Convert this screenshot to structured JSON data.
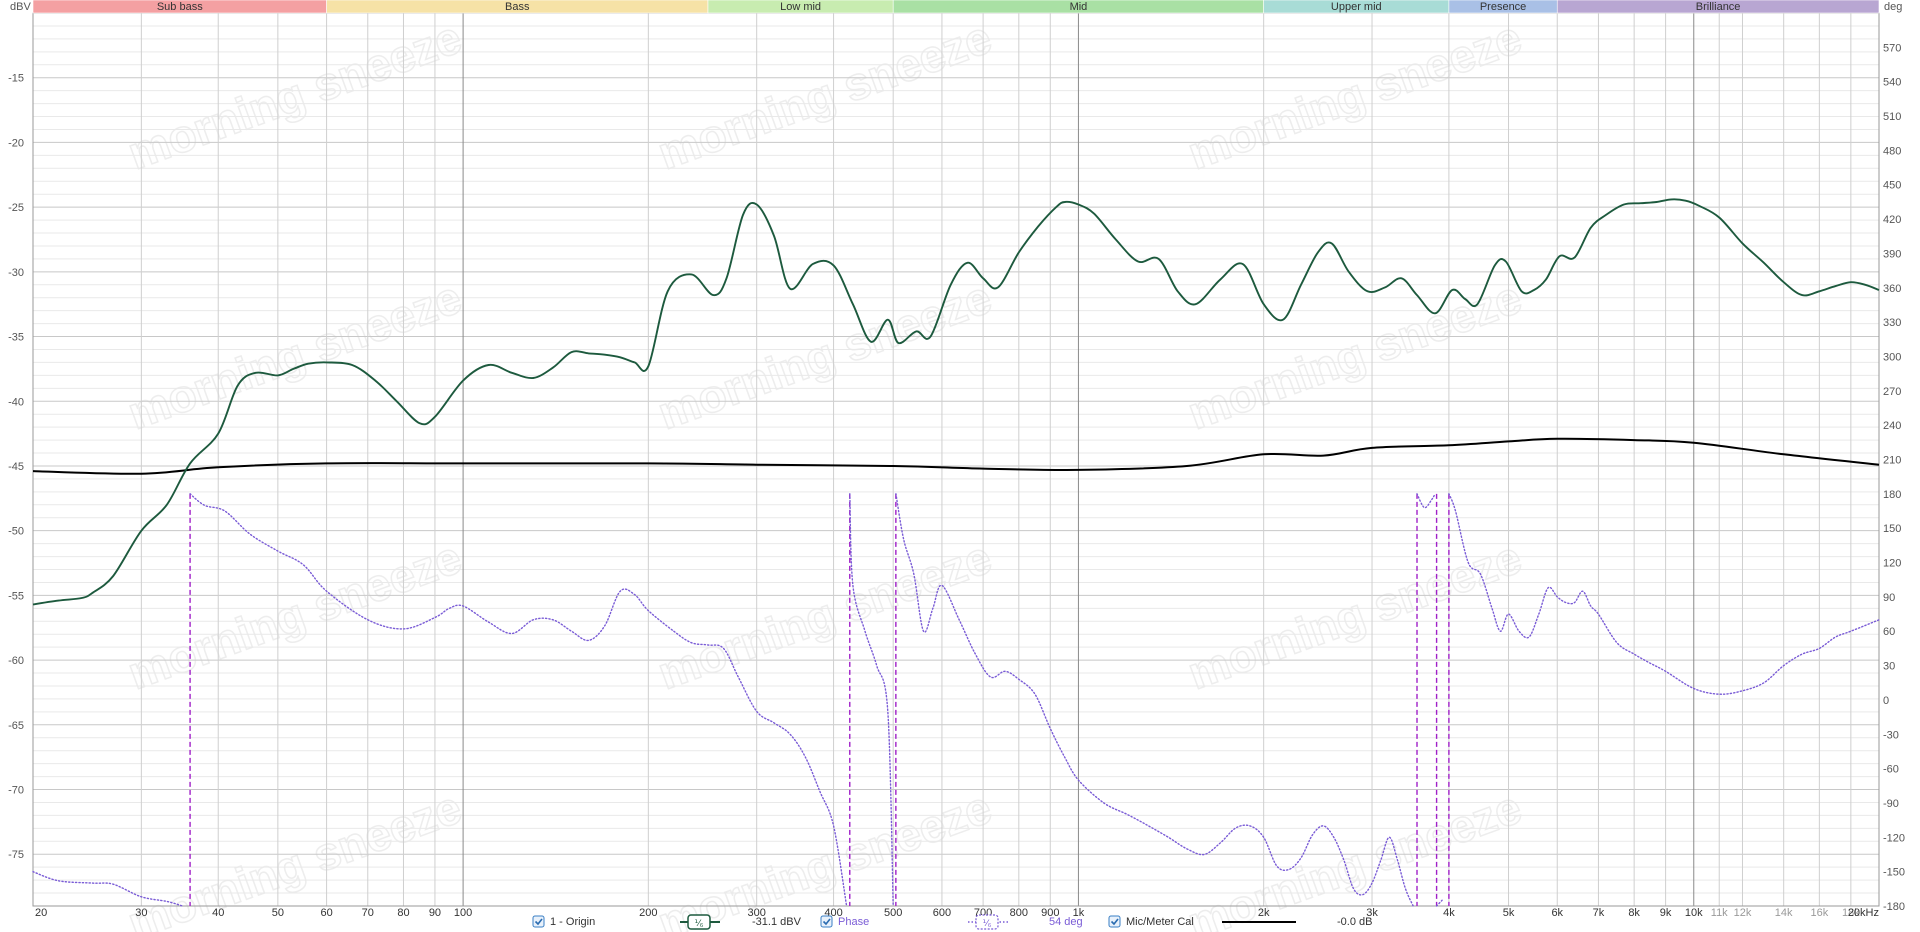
{
  "chart_data": {
    "type": "line",
    "bands": [
      {
        "name": "Sub bass",
        "from": 20,
        "to": 60,
        "color": "#f4a0a2"
      },
      {
        "name": "Bass",
        "from": 60,
        "to": 250,
        "color": "#f6e2a6"
      },
      {
        "name": "Low mid",
        "from": 250,
        "to": 500,
        "color": "#c8ecb0"
      },
      {
        "name": "Mid",
        "from": 500,
        "to": 2000,
        "color": "#a9e0a4"
      },
      {
        "name": "Upper mid",
        "from": 2000,
        "to": 4000,
        "color": "#a8dcd6"
      },
      {
        "name": "Presence",
        "from": 4000,
        "to": 6000,
        "color": "#a9c0e6"
      },
      {
        "name": "Brilliance",
        "from": 6000,
        "to": 20000,
        "color": "#b8a6d2"
      }
    ],
    "ylabel_left": "dBV",
    "ylabel_right": "deg",
    "xlim": [
      20,
      20000
    ],
    "ylim": [
      -79,
      -10
    ],
    "ylim_right": [
      -180,
      600
    ],
    "yticks_left": [
      -15,
      -20,
      -25,
      -30,
      -35,
      -40,
      -45,
      -50,
      -55,
      -60,
      -65,
      -70,
      -75
    ],
    "yticks_right": [
      570,
      540,
      510,
      480,
      450,
      420,
      390,
      360,
      330,
      300,
      270,
      240,
      210,
      180,
      150,
      120,
      90,
      60,
      30,
      0,
      -30,
      -60,
      -90,
      -120,
      -150,
      -180
    ],
    "xticks": [
      {
        "v": 20,
        "label": "20"
      },
      {
        "v": 30,
        "label": "30"
      },
      {
        "v": 40,
        "label": "40"
      },
      {
        "v": 50,
        "label": "50"
      },
      {
        "v": 60,
        "label": "60"
      },
      {
        "v": 70,
        "label": "70"
      },
      {
        "v": 80,
        "label": "80"
      },
      {
        "v": 90,
        "label": "90"
      },
      {
        "v": 100,
        "label": "100"
      },
      {
        "v": 200,
        "label": "200"
      },
      {
        "v": 300,
        "label": "300"
      },
      {
        "v": 400,
        "label": "400"
      },
      {
        "v": 500,
        "label": "500"
      },
      {
        "v": 600,
        "label": "600"
      },
      {
        "v": 700,
        "label": "700"
      },
      {
        "v": 800,
        "label": "800"
      },
      {
        "v": 900,
        "label": "900"
      },
      {
        "v": 1000,
        "label": "1k"
      },
      {
        "v": 2000,
        "label": "2k"
      },
      {
        "v": 3000,
        "label": "3k"
      },
      {
        "v": 4000,
        "label": "4k"
      },
      {
        "v": 5000,
        "label": "5k"
      },
      {
        "v": 6000,
        "label": "6k"
      },
      {
        "v": 7000,
        "label": "7k"
      },
      {
        "v": 8000,
        "label": "8k"
      },
      {
        "v": 9000,
        "label": "9k"
      },
      {
        "v": 10000,
        "label": "10k"
      },
      {
        "v": 11000,
        "label": "11k",
        "faint": true
      },
      {
        "v": 12000,
        "label": "12k",
        "faint": true
      },
      {
        "v": 14000,
        "label": "14k",
        "faint": true
      },
      {
        "v": 16000,
        "label": "16k",
        "faint": true
      },
      {
        "v": 18000,
        "label": "18k",
        "faint": true
      },
      {
        "v": 20000,
        "label": "20kHz"
      }
    ],
    "series": [
      {
        "name": "1 - Origin",
        "axis": "left",
        "color": "#1d5a3e",
        "style": "solid",
        "points": [
          [
            20,
            -55.7
          ],
          [
            22,
            -55.4
          ],
          [
            24,
            -55.2
          ],
          [
            25,
            -54.8
          ],
          [
            27,
            -53.5
          ],
          [
            30,
            -50
          ],
          [
            33,
            -48
          ],
          [
            36,
            -44.8
          ],
          [
            40,
            -42.5
          ],
          [
            43,
            -38.8
          ],
          [
            46,
            -37.8
          ],
          [
            50,
            -38
          ],
          [
            53,
            -37.5
          ],
          [
            56,
            -37.1
          ],
          [
            60,
            -37
          ],
          [
            66,
            -37.2
          ],
          [
            72,
            -38.4
          ],
          [
            78,
            -40
          ],
          [
            85,
            -41.7
          ],
          [
            90,
            -41.2
          ],
          [
            100,
            -38.4
          ],
          [
            110,
            -37.2
          ],
          [
            120,
            -37.8
          ],
          [
            130,
            -38.2
          ],
          [
            140,
            -37.4
          ],
          [
            150,
            -36.2
          ],
          [
            160,
            -36.3
          ],
          [
            170,
            -36.4
          ],
          [
            180,
            -36.6
          ],
          [
            190,
            -37
          ],
          [
            200,
            -37.3
          ],
          [
            215,
            -31.5
          ],
          [
            235,
            -30.2
          ],
          [
            255,
            -31.8
          ],
          [
            268,
            -30.5
          ],
          [
            285,
            -25.6
          ],
          [
            300,
            -24.8
          ],
          [
            320,
            -27.2
          ],
          [
            340,
            -31.3
          ],
          [
            370,
            -29.4
          ],
          [
            400,
            -29.5
          ],
          [
            430,
            -32.5
          ],
          [
            460,
            -35.4
          ],
          [
            490,
            -33.7
          ],
          [
            510,
            -35.5
          ],
          [
            545,
            -34.6
          ],
          [
            575,
            -35
          ],
          [
            620,
            -31
          ],
          [
            660,
            -29.3
          ],
          [
            700,
            -30.5
          ],
          [
            740,
            -31.2
          ],
          [
            800,
            -28.5
          ],
          [
            860,
            -26.5
          ],
          [
            920,
            -25
          ],
          [
            950,
            -24.6
          ],
          [
            1000,
            -24.8
          ],
          [
            1060,
            -25.5
          ],
          [
            1150,
            -27.5
          ],
          [
            1250,
            -29.2
          ],
          [
            1350,
            -29
          ],
          [
            1450,
            -31.5
          ],
          [
            1550,
            -32.5
          ],
          [
            1700,
            -30.6
          ],
          [
            1850,
            -29.4
          ],
          [
            2000,
            -32.5
          ],
          [
            2150,
            -33.7
          ],
          [
            2300,
            -31
          ],
          [
            2450,
            -28.5
          ],
          [
            2580,
            -27.8
          ],
          [
            2750,
            -30
          ],
          [
            2950,
            -31.5
          ],
          [
            3150,
            -31.2
          ],
          [
            3350,
            -30.5
          ],
          [
            3550,
            -31.8
          ],
          [
            3800,
            -33.2
          ],
          [
            4050,
            -31.4
          ],
          [
            4250,
            -32.1
          ],
          [
            4450,
            -32.5
          ],
          [
            4750,
            -29.5
          ],
          [
            4950,
            -29.2
          ],
          [
            5250,
            -31.5
          ],
          [
            5500,
            -31.4
          ],
          [
            5750,
            -30.6
          ],
          [
            6050,
            -28.8
          ],
          [
            6400,
            -28.9
          ],
          [
            6800,
            -26.6
          ],
          [
            7200,
            -25.6
          ],
          [
            7700,
            -24.8
          ],
          [
            8200,
            -24.7
          ],
          [
            8700,
            -24.6
          ],
          [
            9200,
            -24.4
          ],
          [
            9700,
            -24.5
          ],
          [
            10200,
            -24.9
          ],
          [
            11000,
            -25.8
          ],
          [
            12000,
            -27.8
          ],
          [
            13000,
            -29.3
          ],
          [
            14000,
            -30.8
          ],
          [
            15000,
            -31.8
          ],
          [
            16000,
            -31.5
          ],
          [
            17000,
            -31.1
          ],
          [
            18000,
            -30.8
          ],
          [
            19000,
            -31
          ],
          [
            20000,
            -31.4
          ]
        ]
      },
      {
        "name": "Phase",
        "axis": "right",
        "color": "#7a5cd6",
        "style": "dotted",
        "points": [
          [
            20,
            -150
          ],
          [
            22,
            -158
          ],
          [
            25,
            -160
          ],
          [
            27,
            -161
          ],
          [
            30,
            -172
          ],
          [
            33,
            -176
          ],
          [
            35,
            -180
          ],
          [
            36,
            180
          ],
          [
            38,
            170
          ],
          [
            41,
            165
          ],
          [
            45,
            145
          ],
          [
            50,
            130
          ],
          [
            55,
            118
          ],
          [
            60,
            95
          ],
          [
            70,
            70
          ],
          [
            80,
            62
          ],
          [
            90,
            72
          ],
          [
            95,
            80
          ],
          [
            100,
            82
          ],
          [
            110,
            68
          ],
          [
            120,
            58
          ],
          [
            130,
            70
          ],
          [
            140,
            70
          ],
          [
            150,
            60
          ],
          [
            160,
            52
          ],
          [
            170,
            65
          ],
          [
            180,
            95
          ],
          [
            190,
            92
          ],
          [
            200,
            78
          ],
          [
            220,
            60
          ],
          [
            235,
            50
          ],
          [
            250,
            48
          ],
          [
            265,
            45
          ],
          [
            280,
            20
          ],
          [
            300,
            -10
          ],
          [
            320,
            -20
          ],
          [
            340,
            -30
          ],
          [
            360,
            -50
          ],
          [
            380,
            -80
          ],
          [
            400,
            -110
          ],
          [
            420,
            -180
          ],
          [
            425,
            180
          ],
          [
            430,
            100
          ],
          [
            450,
            60
          ],
          [
            470,
            30
          ],
          [
            490,
            -10
          ],
          [
            500,
            -180
          ],
          [
            505,
            180
          ],
          [
            520,
            140
          ],
          [
            540,
            110
          ],
          [
            560,
            60
          ],
          [
            580,
            80
          ],
          [
            600,
            100
          ],
          [
            640,
            70
          ],
          [
            680,
            40
          ],
          [
            720,
            20
          ],
          [
            760,
            25
          ],
          [
            800,
            18
          ],
          [
            850,
            5
          ],
          [
            900,
            -25
          ],
          [
            950,
            -50
          ],
          [
            1000,
            -70
          ],
          [
            1100,
            -90
          ],
          [
            1200,
            -100
          ],
          [
            1300,
            -110
          ],
          [
            1400,
            -120
          ],
          [
            1500,
            -130
          ],
          [
            1600,
            -135
          ],
          [
            1700,
            -125
          ],
          [
            1800,
            -112
          ],
          [
            1900,
            -110
          ],
          [
            2000,
            -120
          ],
          [
            2100,
            -145
          ],
          [
            2200,
            -148
          ],
          [
            2300,
            -138
          ],
          [
            2400,
            -118
          ],
          [
            2500,
            -110
          ],
          [
            2600,
            -120
          ],
          [
            2700,
            -140
          ],
          [
            2800,
            -165
          ],
          [
            2900,
            -170
          ],
          [
            3000,
            -160
          ],
          [
            3100,
            -140
          ],
          [
            3200,
            -120
          ],
          [
            3300,
            -140
          ],
          [
            3400,
            -165
          ],
          [
            3500,
            -180
          ],
          [
            3550,
            180
          ],
          [
            3650,
            168
          ],
          [
            3750,
            175
          ],
          [
            3800,
            180
          ],
          [
            3820,
            -180
          ],
          [
            3900,
            -175
          ],
          [
            4000,
            180
          ],
          [
            4100,
            165
          ],
          [
            4300,
            120
          ],
          [
            4500,
            110
          ],
          [
            4700,
            80
          ],
          [
            4850,
            60
          ],
          [
            5000,
            75
          ],
          [
            5200,
            60
          ],
          [
            5400,
            55
          ],
          [
            5600,
            75
          ],
          [
            5800,
            98
          ],
          [
            6000,
            90
          ],
          [
            6200,
            85
          ],
          [
            6400,
            85
          ],
          [
            6600,
            95
          ],
          [
            6800,
            82
          ],
          [
            7000,
            75
          ],
          [
            7500,
            50
          ],
          [
            8000,
            40
          ],
          [
            8500,
            32
          ],
          [
            9000,
            25
          ],
          [
            10000,
            10
          ],
          [
            11000,
            5
          ],
          [
            12000,
            8
          ],
          [
            13000,
            15
          ],
          [
            14000,
            30
          ],
          [
            15000,
            40
          ],
          [
            16000,
            45
          ],
          [
            17000,
            55
          ],
          [
            18000,
            60
          ],
          [
            20000,
            70
          ]
        ]
      },
      {
        "name": "Mic/Meter Cal",
        "axis": "left",
        "color": "#000000",
        "style": "solid",
        "points": [
          [
            20,
            -45.4
          ],
          [
            30,
            -45.6
          ],
          [
            40,
            -45.1
          ],
          [
            60,
            -44.8
          ],
          [
            100,
            -44.8
          ],
          [
            200,
            -44.8
          ],
          [
            300,
            -44.9
          ],
          [
            500,
            -45
          ],
          [
            700,
            -45.2
          ],
          [
            1000,
            -45.3
          ],
          [
            1500,
            -45
          ],
          [
            2000,
            -44.1
          ],
          [
            2500,
            -44.2
          ],
          [
            3000,
            -43.6
          ],
          [
            4000,
            -43.4
          ],
          [
            5000,
            -43.1
          ],
          [
            6000,
            -42.9
          ],
          [
            8000,
            -43
          ],
          [
            10000,
            -43.2
          ],
          [
            14000,
            -44.1
          ],
          [
            20000,
            -44.9
          ]
        ]
      }
    ]
  },
  "legend": {
    "origin_label": "1 - Origin",
    "origin_value": "-31.1 dBV",
    "phase_label": "Phase",
    "phase_value": "54 deg",
    "cal_label": "Mic/Meter Cal",
    "cal_value": "-0.0 dB",
    "smoothing_glyph": "⅟₆"
  },
  "watermark_text": "morning sneeze"
}
